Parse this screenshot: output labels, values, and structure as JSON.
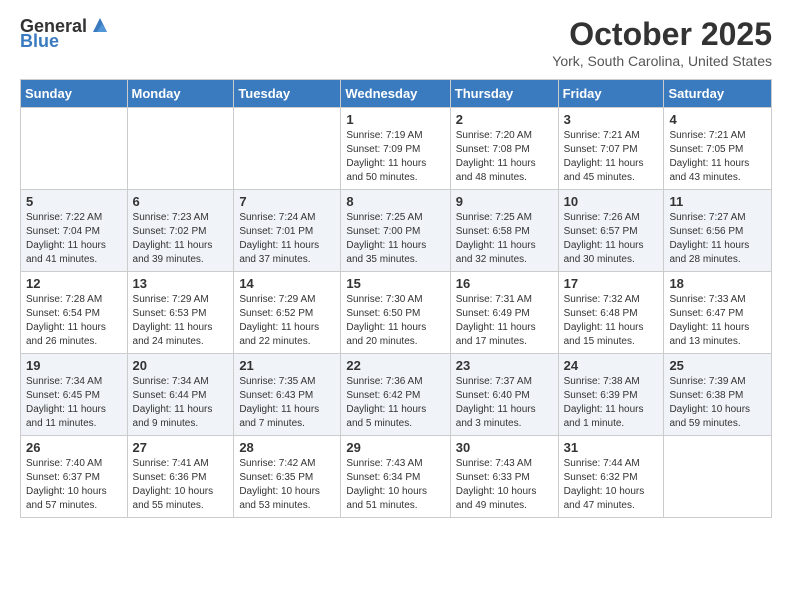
{
  "header": {
    "logo_general": "General",
    "logo_blue": "Blue",
    "title": "October 2025",
    "subtitle": "York, South Carolina, United States"
  },
  "days_of_week": [
    "Sunday",
    "Monday",
    "Tuesday",
    "Wednesday",
    "Thursday",
    "Friday",
    "Saturday"
  ],
  "weeks": [
    [
      {
        "day": "",
        "info": ""
      },
      {
        "day": "",
        "info": ""
      },
      {
        "day": "",
        "info": ""
      },
      {
        "day": "1",
        "info": "Sunrise: 7:19 AM\nSunset: 7:09 PM\nDaylight: 11 hours\nand 50 minutes."
      },
      {
        "day": "2",
        "info": "Sunrise: 7:20 AM\nSunset: 7:08 PM\nDaylight: 11 hours\nand 48 minutes."
      },
      {
        "day": "3",
        "info": "Sunrise: 7:21 AM\nSunset: 7:07 PM\nDaylight: 11 hours\nand 45 minutes."
      },
      {
        "day": "4",
        "info": "Sunrise: 7:21 AM\nSunset: 7:05 PM\nDaylight: 11 hours\nand 43 minutes."
      }
    ],
    [
      {
        "day": "5",
        "info": "Sunrise: 7:22 AM\nSunset: 7:04 PM\nDaylight: 11 hours\nand 41 minutes."
      },
      {
        "day": "6",
        "info": "Sunrise: 7:23 AM\nSunset: 7:02 PM\nDaylight: 11 hours\nand 39 minutes."
      },
      {
        "day": "7",
        "info": "Sunrise: 7:24 AM\nSunset: 7:01 PM\nDaylight: 11 hours\nand 37 minutes."
      },
      {
        "day": "8",
        "info": "Sunrise: 7:25 AM\nSunset: 7:00 PM\nDaylight: 11 hours\nand 35 minutes."
      },
      {
        "day": "9",
        "info": "Sunrise: 7:25 AM\nSunset: 6:58 PM\nDaylight: 11 hours\nand 32 minutes."
      },
      {
        "day": "10",
        "info": "Sunrise: 7:26 AM\nSunset: 6:57 PM\nDaylight: 11 hours\nand 30 minutes."
      },
      {
        "day": "11",
        "info": "Sunrise: 7:27 AM\nSunset: 6:56 PM\nDaylight: 11 hours\nand 28 minutes."
      }
    ],
    [
      {
        "day": "12",
        "info": "Sunrise: 7:28 AM\nSunset: 6:54 PM\nDaylight: 11 hours\nand 26 minutes."
      },
      {
        "day": "13",
        "info": "Sunrise: 7:29 AM\nSunset: 6:53 PM\nDaylight: 11 hours\nand 24 minutes."
      },
      {
        "day": "14",
        "info": "Sunrise: 7:29 AM\nSunset: 6:52 PM\nDaylight: 11 hours\nand 22 minutes."
      },
      {
        "day": "15",
        "info": "Sunrise: 7:30 AM\nSunset: 6:50 PM\nDaylight: 11 hours\nand 20 minutes."
      },
      {
        "day": "16",
        "info": "Sunrise: 7:31 AM\nSunset: 6:49 PM\nDaylight: 11 hours\nand 17 minutes."
      },
      {
        "day": "17",
        "info": "Sunrise: 7:32 AM\nSunset: 6:48 PM\nDaylight: 11 hours\nand 15 minutes."
      },
      {
        "day": "18",
        "info": "Sunrise: 7:33 AM\nSunset: 6:47 PM\nDaylight: 11 hours\nand 13 minutes."
      }
    ],
    [
      {
        "day": "19",
        "info": "Sunrise: 7:34 AM\nSunset: 6:45 PM\nDaylight: 11 hours\nand 11 minutes."
      },
      {
        "day": "20",
        "info": "Sunrise: 7:34 AM\nSunset: 6:44 PM\nDaylight: 11 hours\nand 9 minutes."
      },
      {
        "day": "21",
        "info": "Sunrise: 7:35 AM\nSunset: 6:43 PM\nDaylight: 11 hours\nand 7 minutes."
      },
      {
        "day": "22",
        "info": "Sunrise: 7:36 AM\nSunset: 6:42 PM\nDaylight: 11 hours\nand 5 minutes."
      },
      {
        "day": "23",
        "info": "Sunrise: 7:37 AM\nSunset: 6:40 PM\nDaylight: 11 hours\nand 3 minutes."
      },
      {
        "day": "24",
        "info": "Sunrise: 7:38 AM\nSunset: 6:39 PM\nDaylight: 11 hours\nand 1 minute."
      },
      {
        "day": "25",
        "info": "Sunrise: 7:39 AM\nSunset: 6:38 PM\nDaylight: 10 hours\nand 59 minutes."
      }
    ],
    [
      {
        "day": "26",
        "info": "Sunrise: 7:40 AM\nSunset: 6:37 PM\nDaylight: 10 hours\nand 57 minutes."
      },
      {
        "day": "27",
        "info": "Sunrise: 7:41 AM\nSunset: 6:36 PM\nDaylight: 10 hours\nand 55 minutes."
      },
      {
        "day": "28",
        "info": "Sunrise: 7:42 AM\nSunset: 6:35 PM\nDaylight: 10 hours\nand 53 minutes."
      },
      {
        "day": "29",
        "info": "Sunrise: 7:43 AM\nSunset: 6:34 PM\nDaylight: 10 hours\nand 51 minutes."
      },
      {
        "day": "30",
        "info": "Sunrise: 7:43 AM\nSunset: 6:33 PM\nDaylight: 10 hours\nand 49 minutes."
      },
      {
        "day": "31",
        "info": "Sunrise: 7:44 AM\nSunset: 6:32 PM\nDaylight: 10 hours\nand 47 minutes."
      },
      {
        "day": "",
        "info": ""
      }
    ]
  ]
}
